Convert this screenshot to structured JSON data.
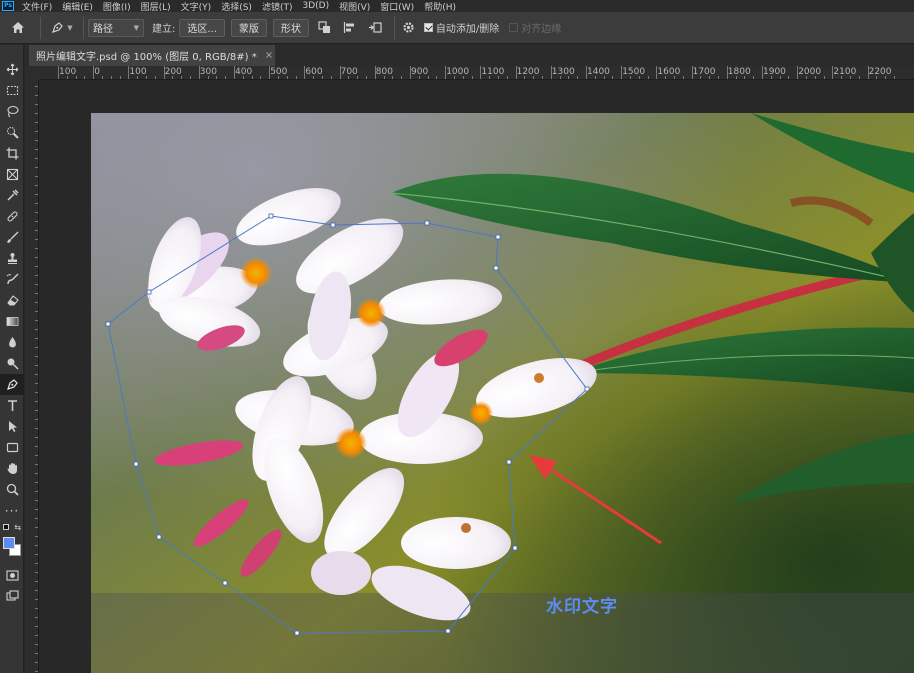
{
  "app": {
    "logo": "Ps"
  },
  "menu": [
    "文件(F)",
    "编辑(E)",
    "图像(I)",
    "图层(L)",
    "文字(Y)",
    "选择(S)",
    "滤镜(T)",
    "3D(D)",
    "视图(V)",
    "窗口(W)",
    "帮助(H)"
  ],
  "options": {
    "mode_value": "路径",
    "make_label": "建立:",
    "selection_btn": "选区...",
    "mask_btn": "蒙版",
    "shape_btn": "形状",
    "auto_add_delete": "自动添加/删除",
    "auto_add_delete_checked": true,
    "align_edges": "对齐边缘",
    "align_edges_checked": false
  },
  "document": {
    "tab_title": "照片编辑文字.psd @ 100% (图层 0, RGB/8#) *",
    "close_glyph": "×"
  },
  "ruler": {
    "top_labels": [
      "100",
      "0",
      "100",
      "200",
      "300",
      "400",
      "500",
      "600",
      "700",
      "800",
      "900",
      "1000",
      "1100",
      "1200",
      "1300",
      "1400",
      "1500",
      "1600",
      "1700",
      "1800",
      "1900",
      "2000",
      "2100",
      "2200"
    ]
  },
  "colors": {
    "foreground": "#5b8df5",
    "background": "#ffffff",
    "path_stroke": "#4a78c8",
    "arrow": "#e83a3a"
  },
  "tools": [
    "move-icon",
    "marquee-icon",
    "lasso-icon",
    "quick-select-icon",
    "crop-icon",
    "frame-icon",
    "eyedropper-icon",
    "healing-icon",
    "brush-icon",
    "stamp-icon",
    "history-brush-icon",
    "eraser-icon",
    "gradient-icon",
    "blur-icon",
    "dodge-icon",
    "pen-icon",
    "type-icon",
    "path-select-icon",
    "rectangle-icon",
    "hand-icon",
    "zoom-icon",
    "more-icon"
  ],
  "active_tool": "pen-icon",
  "canvas": {
    "watermark_text": "水印文字"
  }
}
